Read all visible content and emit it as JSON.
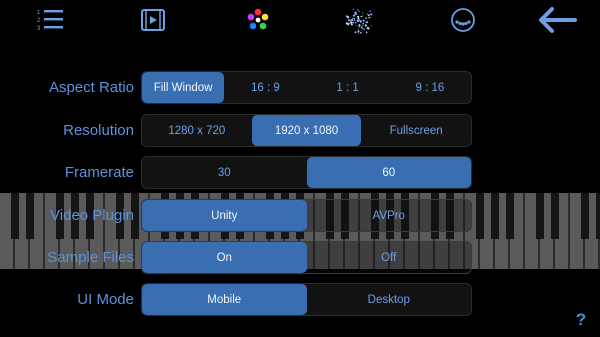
{
  "toolbar": {
    "items": [
      {
        "name": "list-numbered-icon"
      },
      {
        "name": "video-icon"
      },
      {
        "name": "color-palette-icon"
      },
      {
        "name": "particles-icon"
      },
      {
        "name": "dots-circle-icon"
      },
      {
        "name": "back-arrow-icon"
      }
    ],
    "list_digits": [
      "1",
      "2",
      "3"
    ]
  },
  "settings": {
    "aspect_ratio": {
      "label": "Aspect Ratio",
      "options": [
        "Fill Window",
        "16 : 9",
        "1 : 1",
        "9 : 16"
      ],
      "selected": 0
    },
    "resolution": {
      "label": "Resolution",
      "options": [
        "1280 x 720",
        "1920 x 1080",
        "Fullscreen"
      ],
      "selected": 1
    },
    "framerate": {
      "label": "Framerate",
      "options": [
        "30",
        "60"
      ],
      "selected": 1
    },
    "video_plugin": {
      "label": "Video Plugin",
      "options": [
        "Unity",
        "AVPro"
      ],
      "selected": 0
    },
    "sample_files": {
      "label": "Sample Files",
      "options": [
        "On",
        "Off"
      ],
      "selected": 0
    },
    "ui_mode": {
      "label": "UI Mode",
      "options": [
        "Mobile",
        "Desktop"
      ],
      "selected": 0
    }
  },
  "help": {
    "label": "?"
  },
  "colors": {
    "accent": "#3a6eb2",
    "text": "#5d92dc",
    "background": "#000000"
  }
}
